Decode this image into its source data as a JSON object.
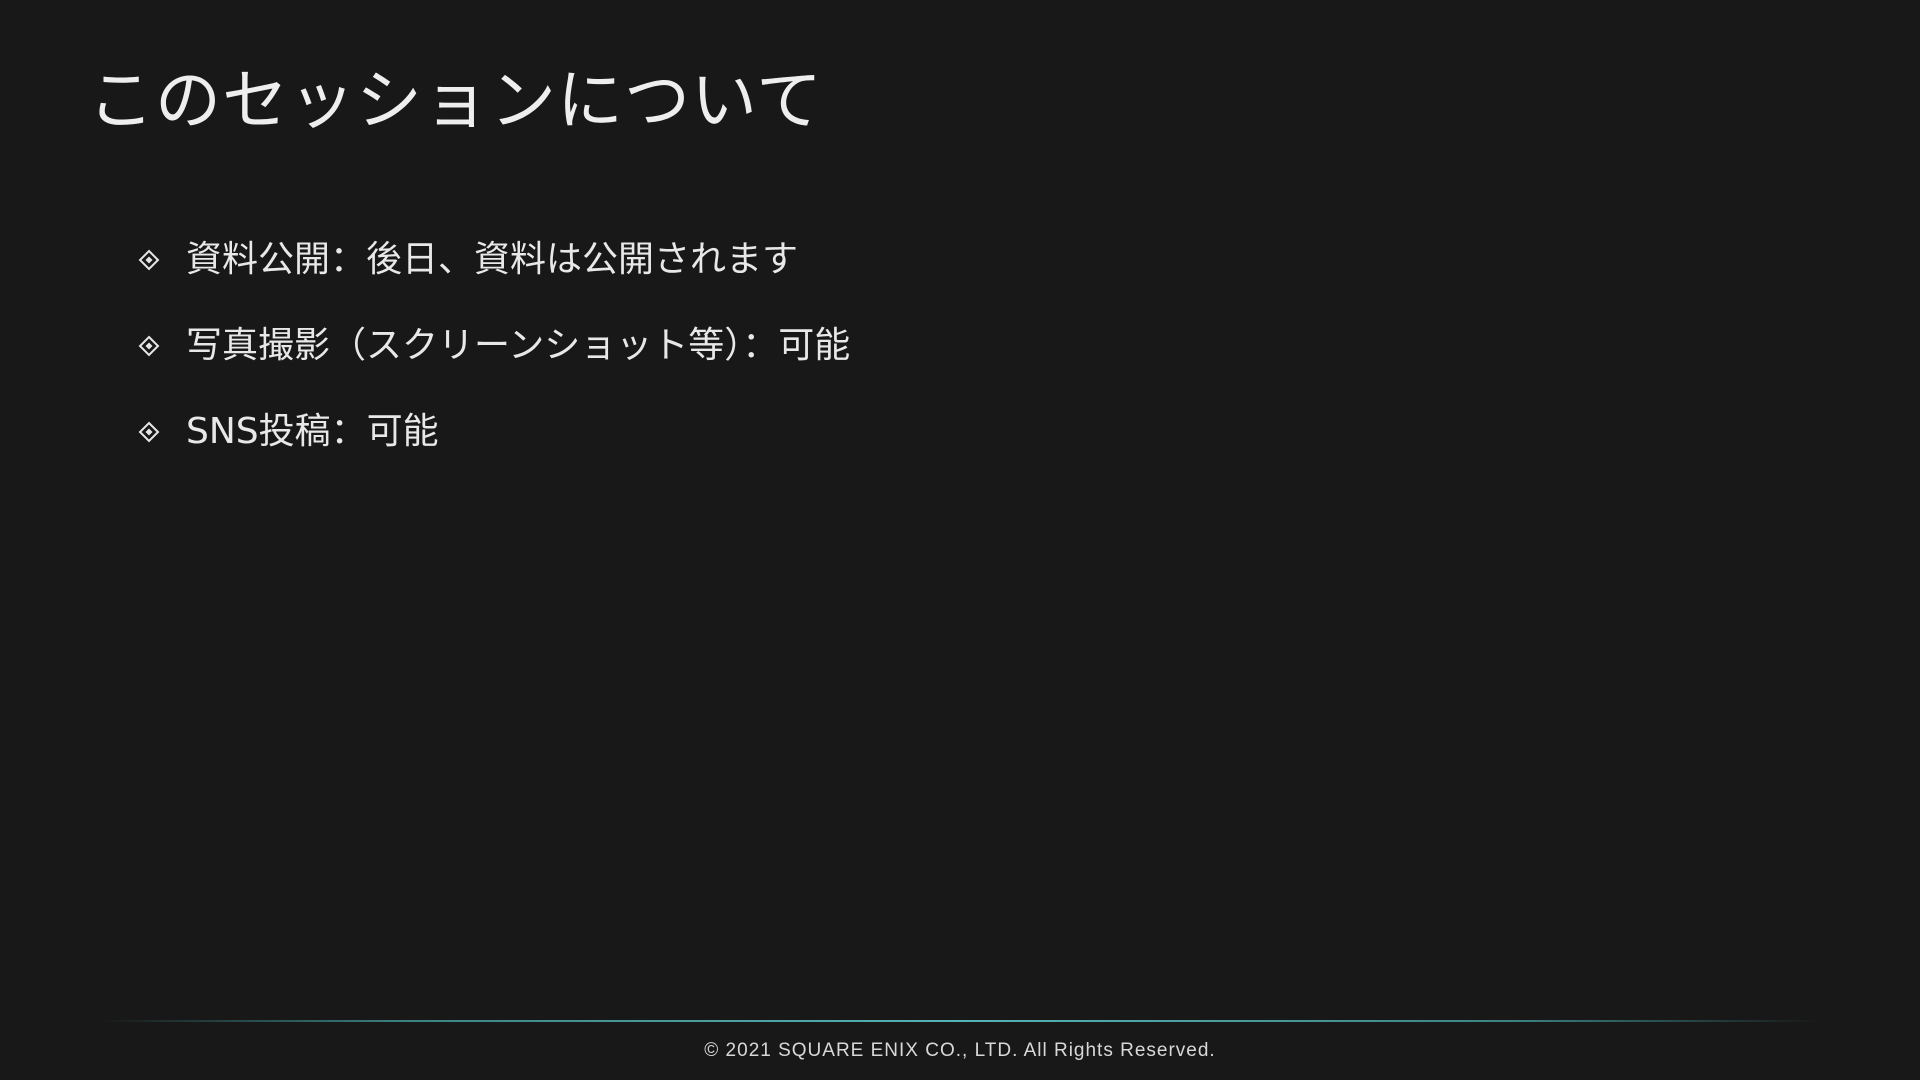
{
  "slide": {
    "title": "このセッションについて",
    "bullets": [
      {
        "icon": "diamond-bullet-icon",
        "text": "資料公開：後日、資料は公開されます"
      },
      {
        "icon": "diamond-bullet-icon",
        "text": "写真撮影（スクリーンショット等）：可能"
      },
      {
        "icon": "diamond-bullet-icon",
        "text": "SNS投稿：可能"
      }
    ],
    "footer": {
      "copyright": "© 2021 SQUARE ENIX CO., LTD. All Rights Reserved."
    }
  },
  "colors": {
    "background": "#181818",
    "text": "#e9e9e9",
    "divider_accent": "#55b4b4"
  }
}
